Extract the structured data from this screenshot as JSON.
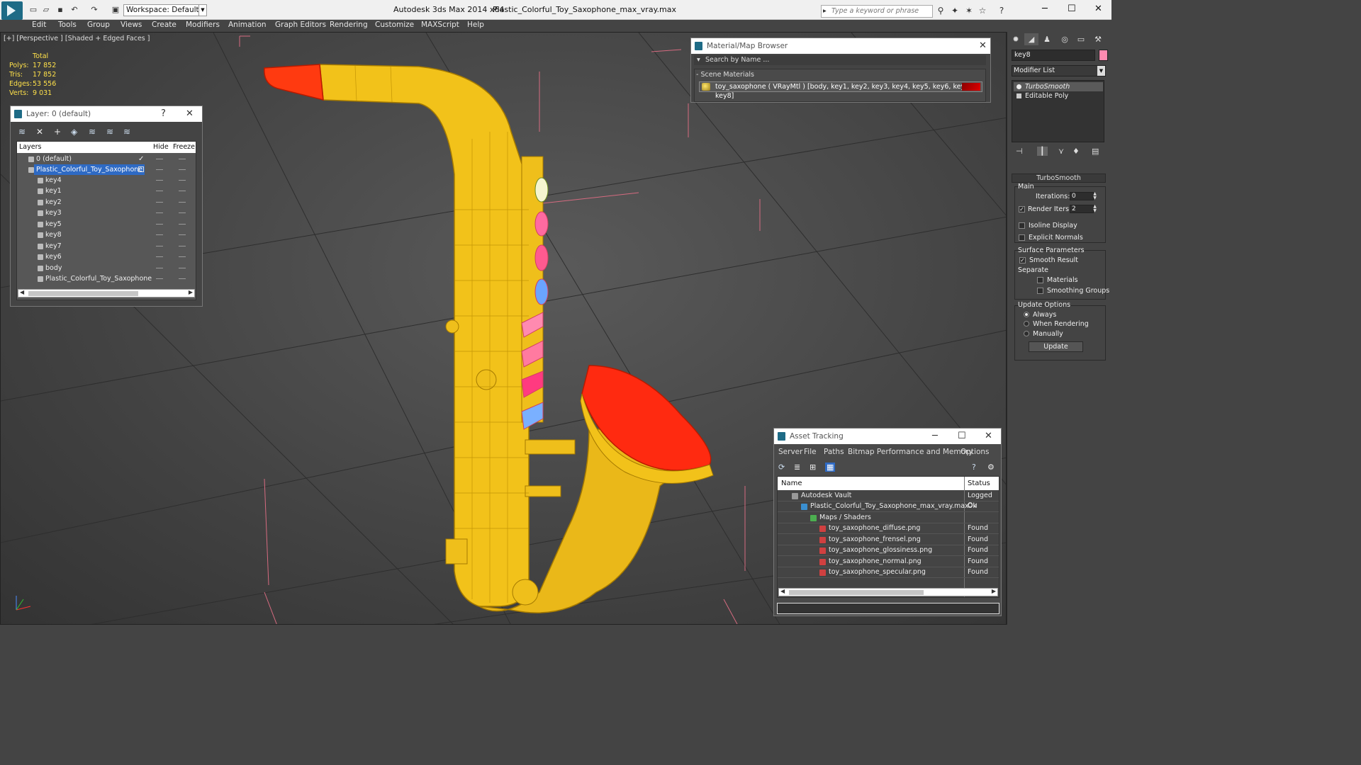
{
  "titlebar": {
    "workspace": "Workspace: Default",
    "app_title": "Autodesk 3ds Max  2014 x64",
    "file_title": "Plastic_Colorful_Toy_Saxophone_max_vray.max",
    "search_placeholder": "Type a keyword or phrase"
  },
  "menu": [
    "Edit",
    "Tools",
    "Group",
    "Views",
    "Create",
    "Modifiers",
    "Animation",
    "Graph Editors",
    "Rendering",
    "Customize",
    "MAXScript",
    "Help"
  ],
  "viewport": {
    "label": "[+] [Perspective ] [Shaded + Edged Faces ]",
    "stats_header": "Total",
    "stats": [
      {
        "label": "Polys:",
        "value": "17 852"
      },
      {
        "label": "Tris:",
        "value": "17 852"
      },
      {
        "label": "Edges:",
        "value": "53 556"
      },
      {
        "label": "Verts:",
        "value": "9 031"
      }
    ],
    "colors": {
      "body": "#f2c21a",
      "wire": "#b88a00",
      "bell": "#ff2a10",
      "mouthpiece": "#ff3a10"
    }
  },
  "layer_window": {
    "title": "Layer: 0 (default)",
    "help": "?",
    "col_layers": "Layers",
    "col_hide": "Hide",
    "col_freeze": "Freeze",
    "rows": [
      {
        "name": "0 (default)",
        "indent": 0
      },
      {
        "name": "Plastic_Colorful_Toy_Saxophone",
        "indent": 0
      },
      {
        "name": "key4",
        "indent": 1
      },
      {
        "name": "key1",
        "indent": 1
      },
      {
        "name": "key2",
        "indent": 1
      },
      {
        "name": "key3",
        "indent": 1
      },
      {
        "name": "key5",
        "indent": 1
      },
      {
        "name": "key8",
        "indent": 1
      },
      {
        "name": "key7",
        "indent": 1
      },
      {
        "name": "key6",
        "indent": 1
      },
      {
        "name": "body",
        "indent": 1
      },
      {
        "name": "Plastic_Colorful_Toy_Saxophone",
        "indent": 1
      }
    ]
  },
  "material_browser": {
    "title": "Material/Map Browser",
    "search": "Search by Name ...",
    "section": "- Scene Materials",
    "item": "toy_saxophone  ( VRayMtl )  [body, key1, key2, key3, key4, key5, key6, key7, key8]"
  },
  "command_panel": {
    "object_name": "key8",
    "modifier_list": "Modifier List",
    "stack": [
      "TurboSmooth",
      "Editable Poly"
    ],
    "rollout": "TurboSmooth",
    "main": "Main",
    "iterations_label": "Iterations:",
    "iterations": "0",
    "render_iters_label": "Render Iters:",
    "render_iters": "2",
    "isoline": "Isoline Display",
    "explicit_normals": "Explicit Normals",
    "surface_params": "Surface Parameters",
    "smooth_result": "Smooth Result",
    "separate": "Separate",
    "materials": "Materials",
    "smoothing_groups": "Smoothing Groups",
    "update_options": "Update Options",
    "always": "Always",
    "when_rendering": "When Rendering",
    "manually": "Manually",
    "update_btn": "Update"
  },
  "asset_tracking": {
    "title": "Asset Tracking",
    "menu": [
      "Server",
      "File",
      "Paths",
      "Bitmap Performance and Memory",
      "Options"
    ],
    "col_name": "Name",
    "col_status": "Status",
    "rows": [
      {
        "name": "Autodesk Vault",
        "status": "Logged Ou",
        "indent": 1,
        "icon": "#999999"
      },
      {
        "name": "Plastic_Colorful_Toy_Saxophone_max_vray.max",
        "status": "Ok",
        "indent": 2,
        "icon": "#3a8fd0"
      },
      {
        "name": "Maps / Shaders",
        "status": "",
        "indent": 3,
        "icon": "#4caf50"
      },
      {
        "name": "toy_saxophone_diffuse.png",
        "status": "Found",
        "indent": 4,
        "icon": "#d04040"
      },
      {
        "name": "toy_saxophone_frensel.png",
        "status": "Found",
        "indent": 4,
        "icon": "#d04040"
      },
      {
        "name": "toy_saxophone_glossiness.png",
        "status": "Found",
        "indent": 4,
        "icon": "#d04040"
      },
      {
        "name": "toy_saxophone_normal.png",
        "status": "Found",
        "indent": 4,
        "icon": "#d04040"
      },
      {
        "name": "toy_saxophone_specular.png",
        "status": "Found",
        "indent": 4,
        "icon": "#d04040"
      }
    ]
  }
}
